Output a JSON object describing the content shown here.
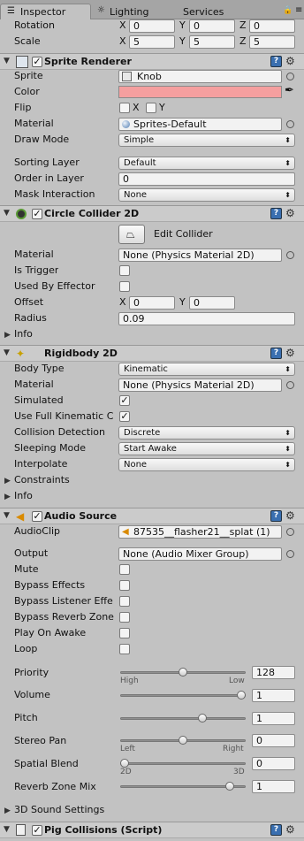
{
  "tabs": [
    {
      "label": "Inspector"
    },
    {
      "label": "Lighting"
    },
    {
      "label": "Services"
    }
  ],
  "transform": {
    "rotation": {
      "label": "Rotation",
      "x": "0",
      "y": "0",
      "z": "0"
    },
    "scale": {
      "label": "Scale",
      "x": "5",
      "y": "5",
      "z": "5"
    },
    "axis": {
      "x": "X",
      "y": "Y",
      "z": "Z"
    }
  },
  "sprite_renderer": {
    "title": "Sprite Renderer",
    "sprite_label": "Sprite",
    "sprite_value": "Knob",
    "color_label": "Color",
    "color_value": "#f59f9f",
    "flip_label": "Flip",
    "flip_x": "X",
    "flip_y": "Y",
    "material_label": "Material",
    "material_value": "Sprites-Default",
    "draw_mode_label": "Draw Mode",
    "draw_mode_value": "Simple",
    "sorting_layer_label": "Sorting Layer",
    "sorting_layer_value": "Default",
    "order_label": "Order in Layer",
    "order_value": "0",
    "mask_label": "Mask Interaction",
    "mask_value": "None"
  },
  "circle_collider": {
    "title": "Circle Collider 2D",
    "edit_button": "Edit Collider",
    "material_label": "Material",
    "material_value": "None (Physics Material 2D)",
    "trigger_label": "Is Trigger",
    "effector_label": "Used By Effector",
    "offset_label": "Offset",
    "offset_x": "0",
    "offset_y": "0",
    "radius_label": "Radius",
    "radius_value": "0.09",
    "info_label": "Info"
  },
  "rigidbody": {
    "title": "Rigidbody 2D",
    "body_type_label": "Body Type",
    "body_type_value": "Kinematic",
    "material_label": "Material",
    "material_value": "None (Physics Material 2D)",
    "simulated_label": "Simulated",
    "full_kinematic_label": "Use Full Kinematic C",
    "collision_label": "Collision Detection",
    "collision_value": "Discrete",
    "sleeping_label": "Sleeping Mode",
    "sleeping_value": "Start Awake",
    "interpolate_label": "Interpolate",
    "interpolate_value": "None",
    "constraints_label": "Constraints",
    "info_label": "Info"
  },
  "audio_source": {
    "title": "Audio Source",
    "clip_label": "AudioClip",
    "clip_value": "87535__flasher21__splat (1)",
    "output_label": "Output",
    "output_value": "None (Audio Mixer Group)",
    "mute_label": "Mute",
    "bypass_effects_label": "Bypass Effects",
    "bypass_listener_label": "Bypass Listener Effe",
    "bypass_reverb_label": "Bypass Reverb Zone",
    "play_on_awake_label": "Play On Awake",
    "loop_label": "Loop",
    "priority_label": "Priority",
    "priority_value": "128",
    "priority_level": 0.5,
    "priority_low": "High",
    "priority_high": "Low",
    "volume_label": "Volume",
    "volume_value": "1",
    "volume_level": 1.0,
    "pitch_label": "Pitch",
    "pitch_value": "1",
    "pitch_level": 0.67,
    "stereo_label": "Stereo Pan",
    "stereo_value": "0",
    "stereo_level": 0.5,
    "stereo_left": "Left",
    "stereo_right": "Right",
    "spatial_label": "Spatial Blend",
    "spatial_value": "0",
    "spatial_level": 0.0,
    "spatial_low": "2D",
    "spatial_high": "3D",
    "reverb_label": "Reverb Zone Mix",
    "reverb_value": "1",
    "reverb_level": 0.9,
    "sound3d_label": "3D Sound Settings"
  },
  "pig_collisions": {
    "title": "Pig Collisions (Script)"
  }
}
